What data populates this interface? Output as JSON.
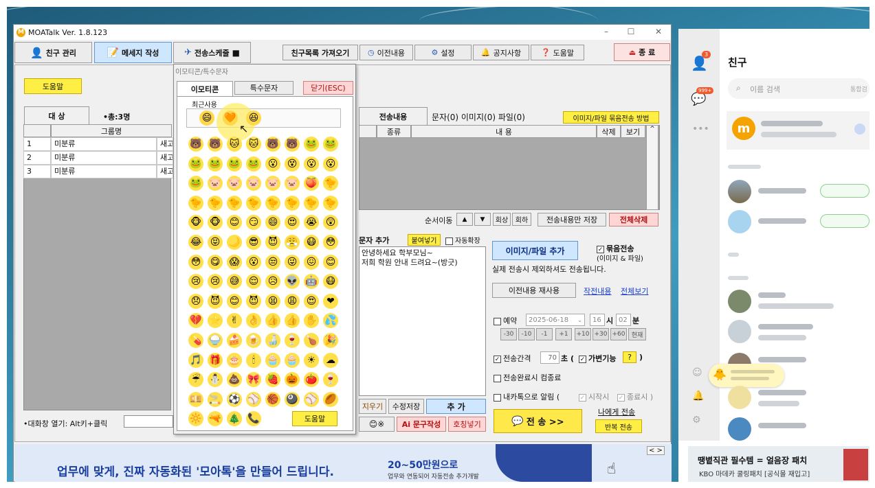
{
  "window": {
    "title": "MOATalk Ver. 1.8.123",
    "minimize": "–",
    "maximize": "☐",
    "close": "✕"
  },
  "toolbar": {
    "friend_mgmt": "친구 관리",
    "compose": "메세지 작성",
    "schedule": "전송스케줄",
    "fetch_friends": "친구목록 가져오기",
    "history": "이전내용",
    "settings": "설정",
    "notice": "공지사항",
    "help": "도움말",
    "exit": "종 료"
  },
  "left": {
    "help_btn": "도움말",
    "tab_target": "대 상",
    "count_label": "•총:3명",
    "col_group": "그룹명",
    "rows": [
      {
        "no": "1",
        "group": "미분류",
        "extra": "새고"
      },
      {
        "no": "2",
        "group": "미분류",
        "extra": "새고"
      },
      {
        "no": "3",
        "group": "미분류",
        "extra": "새고"
      }
    ],
    "footer_hint": "•대화창 열기: Alt키+클릭"
  },
  "emoji_popup": {
    "title": "이모티콘/특수문자",
    "tab_emoticon": "이모티콘",
    "tab_special": "특수문자",
    "close_btn": "닫기(ESC)",
    "recent_label": "최근사용",
    "recent": [
      "😄",
      "🧡",
      "😆"
    ],
    "grid": [
      [
        "🐻",
        "🐻",
        "🐱",
        "🐱",
        "🐻",
        "🐻",
        "🐸",
        "🐸"
      ],
      [
        "🐸",
        "🐸",
        "🐸",
        "🐸",
        "😮",
        "😵",
        "😮",
        "😮"
      ],
      [
        "🐸",
        "🐷",
        "🐷",
        "🐷",
        "🐷",
        "🐷",
        "🍑",
        "🐤"
      ],
      [
        "🐤",
        "🐤",
        "🐤",
        "🐤",
        "🐤",
        "🐤",
        "🐤",
        "🐤"
      ],
      [
        "🐵",
        "🐵",
        "😊",
        "😏",
        "😄",
        "😍",
        "😭",
        "😲"
      ],
      [
        "😂",
        "😝",
        "🌙",
        "😎",
        "😈",
        "😤",
        "😷",
        "😳"
      ],
      [
        "😳",
        "😋",
        "😱",
        "😮",
        "😒",
        "😜",
        "😖",
        "😊"
      ],
      [
        "😢",
        "😢",
        "😅",
        "😌",
        "😥",
        "👽",
        "🤖",
        "😷"
      ],
      [
        "😞",
        "😈",
        "😊",
        "😈",
        "😫",
        "😩",
        "😍",
        "❤"
      ],
      [
        "💔",
        "⭐",
        "✌",
        "👌",
        "👍",
        "👍",
        "✋",
        "💦"
      ],
      [
        "💊",
        "🍚",
        "🍰",
        "🍺",
        "🍶",
        "🍷",
        "🍗",
        "🎉"
      ],
      [
        "🎵",
        "🎁",
        "🎂",
        "🕯",
        "🧁",
        "🧁",
        "☀",
        "☁"
      ],
      [
        "☔",
        "⛄",
        "💩",
        "🎀",
        "🍓",
        "🎃",
        "🍅",
        "🍷"
      ],
      [
        "💴",
        "🚬",
        "⚽",
        "⚾",
        "🏀",
        "🎱",
        "⚾",
        "🏉"
      ],
      [
        "🔆",
        "🔫",
        "🎄",
        "📞"
      ]
    ],
    "help_btn": "도움말"
  },
  "center": {
    "tab_content": "전송내용",
    "tab_summary": "문자(0) 이미지(0) 파일(0)",
    "method_btn": "이미지/파일 묶음전송 방법",
    "col_type": "종류",
    "col_content": "내  용",
    "col_delete": "삭제",
    "col_view": "보기",
    "order_label": "순서이동",
    "up": "▲",
    "down": "▼",
    "back": "회상",
    "bottom": "회하",
    "save_only": "전송내용만 저장",
    "delete_all": "전체삭제",
    "text_add_label": "문자 추가",
    "paste_btn": "붙여넣기",
    "auto_expand": "자동확장",
    "message_lines": [
      "안녕하세요 학부모님~",
      "저희 학원 안내 드려요~(방긋)"
    ],
    "clear_btn": "지우기",
    "edit_save_btn": "수정저장",
    "add_btn": "추 가",
    "emoji_sym": "😊※",
    "ai_btn": "Ai 문구작성",
    "honorific_btn": "호칭넣기"
  },
  "right": {
    "add_image_btn": "이미지/파일 추가",
    "bundle_label": "묶음전송",
    "bundle_sub": "(이미지 & 파일)",
    "note": "실제 전송시 제외하셔도 전송됩니다.",
    "reuse_btn": "이전내용 재사용",
    "prev_link": "작전내용",
    "view_all_link": "전체보기",
    "reserve_label": "예약",
    "reserve_date": "2025-06-18",
    "reserve_hour": "16",
    "hour_unit": "시",
    "reserve_min": "02",
    "min_unit": "분",
    "offsets": [
      "-30",
      "-10",
      "-1",
      "+1",
      "+10",
      "+30",
      "+60",
      "현재"
    ],
    "interval_label": "전송간격",
    "interval_value": "70",
    "interval_unit": "초 (",
    "variable_label": "가변기능",
    "q_btn": "?",
    "close_paren": ")",
    "done_label": "전송완료시 컴종료",
    "kakao_label": "내카톡으로 알림 (",
    "start_label": "시작시",
    "end_label": "종료시 )",
    "send_btn": "전 송 >>",
    "send_me_link": "나에게 전송",
    "repeat_btn": "반복 전송"
  },
  "banner": {
    "headline": "업무에 맞게, 진짜 자동화된 '모아톡'을 만들어 드립니다.",
    "price": "20~50만원으로",
    "sub": "업무와 연동되어 자동전송 추가개발",
    "nav": "< >"
  },
  "sidebar": {
    "badge_people": "3",
    "badge_chat": "999+",
    "title": "친구",
    "search_placeholder": "이름 검색",
    "search_extra": "통합검",
    "toast_text": "",
    "ad_title": "땡볕직관 필수템 = 얼음장 패치",
    "ad_sub": "KBO 마데카 쿨링패치 [공식몰 재입고]"
  },
  "colors": {
    "yellow": "#ffee44",
    "pink": "#ffd6d6",
    "blue": "#cfe6ff",
    "accent_red": "#d02020"
  }
}
